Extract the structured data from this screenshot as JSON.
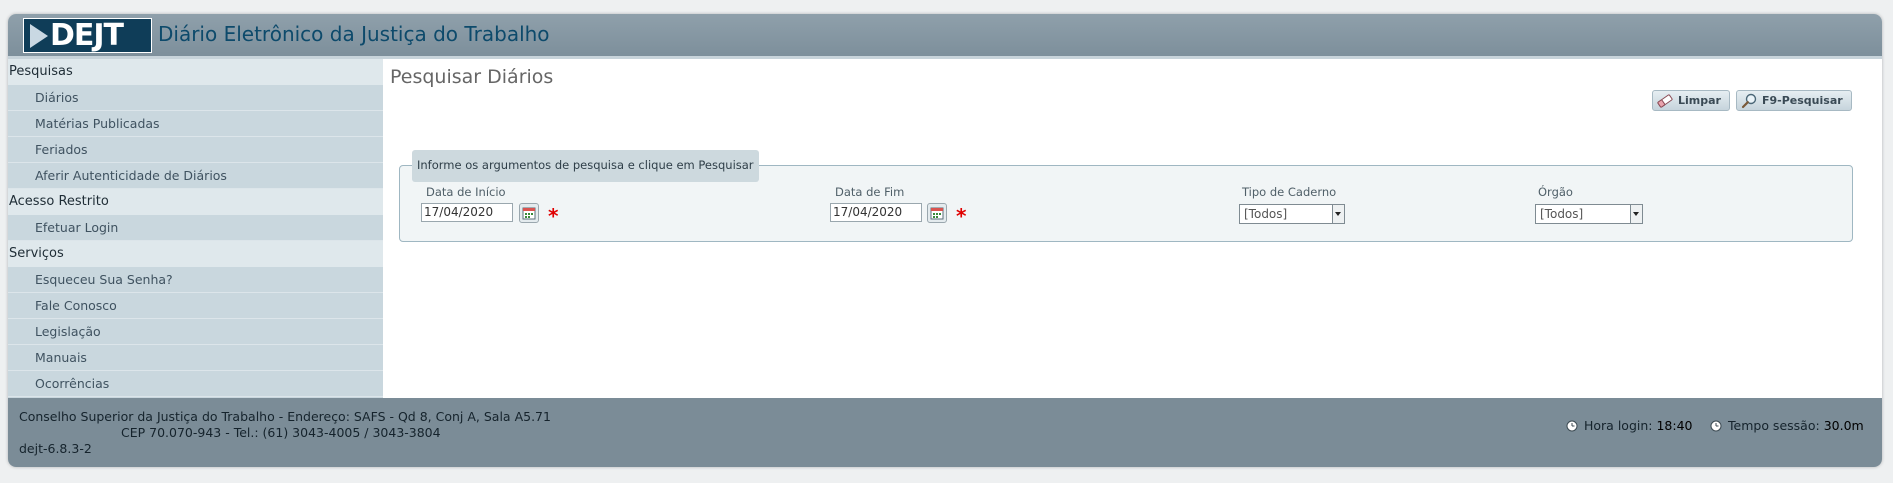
{
  "header": {
    "logo_text": "DEJT",
    "title": "Diário Eletrônico da Justiça do Trabalho"
  },
  "sidebar": {
    "sections": [
      {
        "label": "Pesquisas",
        "items": [
          "Diários",
          "Matérias Publicadas",
          "Feriados",
          "Aferir Autenticidade de Diários"
        ]
      },
      {
        "label": "Acesso Restrito",
        "items": [
          "Efetuar Login"
        ]
      },
      {
        "label": "Serviços",
        "items": [
          "Esqueceu Sua Senha?",
          "Fale Conosco",
          "Legislação",
          "Manuais",
          "Ocorrências"
        ]
      }
    ]
  },
  "main": {
    "title": "Pesquisar Diários",
    "buttons": {
      "clear": "Limpar",
      "search": "F9-Pesquisar"
    },
    "form": {
      "legend": "Informe os argumentos de pesquisa e clique em Pesquisar",
      "start_date": {
        "label": "Data de Início",
        "value": "17/04/2020"
      },
      "end_date": {
        "label": "Data de Fim",
        "value": "17/04/2020"
      },
      "notebook_type": {
        "label": "Tipo de Caderno",
        "value": "[Todos]"
      },
      "organ": {
        "label": "Órgão",
        "value": "[Todos]"
      },
      "required_mark": "*"
    }
  },
  "footer": {
    "line1": "Conselho Superior da Justiça do Trabalho - Endereço: SAFS - Qd 8, Conj A, Sala A5.71",
    "line2": "CEP 70.070-943 - Tel.: (61) 3043-4005 / 3043-3804",
    "version": "dejt-6.8.3-2",
    "login_time_label": "Hora login:",
    "login_time_value": "18:40",
    "session_time_label": "Tempo sessão:",
    "session_time_value": "30.0m"
  },
  "colors": {
    "header_bg": "#8a9ba6",
    "sidebar_bg": "#c9d7de",
    "footer_bg": "#7b8c97",
    "title_blue": "#0d4a6b",
    "required_red": "#e00000"
  }
}
